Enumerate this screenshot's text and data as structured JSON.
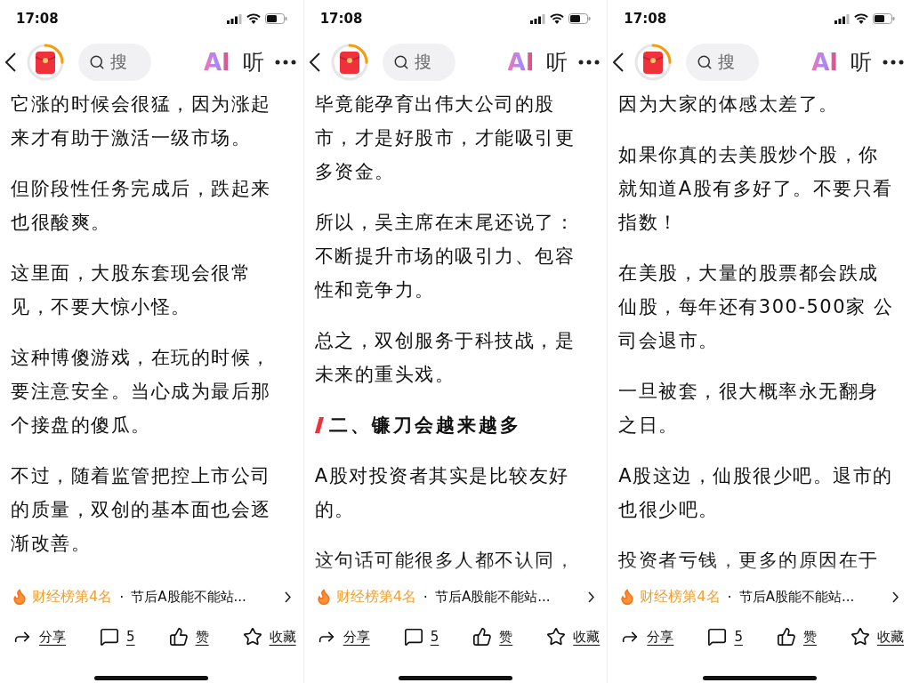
{
  "screens": [
    {
      "status_bar": {
        "time": "17:08"
      },
      "nav": {
        "search": {
          "placeholder": "搜"
        },
        "ai_label": "AI",
        "listen_label": "听"
      },
      "article": [
        {
          "kind": "paragraph",
          "lines": [
            "它涨的时候会很猛，因为涨起",
            "来才有助于激活一级市场。"
          ]
        },
        {
          "kind": "paragraph",
          "lines": [
            "但阶段性任务完成后，跌起来",
            "也很酸爽。"
          ]
        },
        {
          "kind": "paragraph",
          "lines": [
            "这里面，大股东套现会很常",
            "见，不要大惊小怪。"
          ]
        },
        {
          "kind": "paragraph",
          "lines": [
            "这种博傻游戏，在玩的时候，",
            "要注意安全。当心成为最后那",
            "个接盘的傻瓜。"
          ]
        },
        {
          "kind": "paragraph",
          "lines": [
            "不过，随着监管把控上市公司",
            "的质量，双创的基本面也会逐",
            "渐改善。"
          ]
        }
      ],
      "ranking": {
        "label": "财经榜第4名",
        "separator": "·",
        "headline": "节后A股能不能站..."
      },
      "actions": [
        {
          "kind": "share",
          "label": "分享"
        },
        {
          "kind": "comment",
          "label": "5"
        },
        {
          "kind": "like",
          "label": "赞"
        },
        {
          "kind": "favorite",
          "label": "收藏"
        }
      ]
    },
    {
      "status_bar": {
        "time": "17:08"
      },
      "nav": {
        "search": {
          "placeholder": "搜"
        },
        "ai_label": "AI",
        "listen_label": "听"
      },
      "article": [
        {
          "kind": "paragraph",
          "lines": [
            "毕竟能孕育出伟大公司的股",
            "市，才是好股市，才能吸引更",
            "多资金。"
          ]
        },
        {
          "kind": "paragraph",
          "lines": [
            "所以，吴主席在末尾还说了：",
            "不断提升市场的吸引力、包容",
            "性和竞争力。"
          ]
        },
        {
          "kind": "paragraph",
          "lines": [
            "总之，双创服务于科技战，是",
            "未来的重头戏。"
          ]
        },
        {
          "kind": "heading",
          "lines": [
            "二、镰刀会越来越多"
          ]
        },
        {
          "kind": "paragraph",
          "lines": [
            "A股对投资者其实是比较友好",
            "的。"
          ]
        },
        {
          "kind": "paragraph",
          "lines": [
            "这句话可能很多人都不认同，"
          ]
        }
      ],
      "ranking": {
        "label": "财经榜第4名",
        "separator": "·",
        "headline": "节后A股能不能站..."
      },
      "actions": [
        {
          "kind": "share",
          "label": "分享"
        },
        {
          "kind": "comment",
          "label": "5"
        },
        {
          "kind": "like",
          "label": "赞"
        },
        {
          "kind": "favorite",
          "label": "收藏"
        }
      ]
    },
    {
      "status_bar": {
        "time": "17:08"
      },
      "nav": {
        "search": {
          "placeholder": "搜"
        },
        "ai_label": "AI",
        "listen_label": "听"
      },
      "article": [
        {
          "kind": "paragraph",
          "lines": [
            "因为大家的体感太差了。"
          ]
        },
        {
          "kind": "paragraph",
          "lines": [
            "如果你真的去美股炒个股，你",
            "就知道A股有多好了。不要只看",
            "指数！"
          ]
        },
        {
          "kind": "paragraph",
          "lines": [
            "在美股，大量的股票都会跌成",
            "仙股，每年还有300-500家 公",
            "司会退市。"
          ]
        },
        {
          "kind": "paragraph",
          "lines": [
            "一旦被套，很大概率永无翻身",
            "之日。"
          ]
        },
        {
          "kind": "paragraph",
          "lines": [
            "A股这边，仙股很少吧。退市的",
            "也很少吧。"
          ]
        },
        {
          "kind": "paragraph",
          "lines": [
            "投资者亏钱，更多的原因在于"
          ]
        }
      ],
      "ranking": {
        "label": "财经榜第4名",
        "separator": "·",
        "headline": "节后A股能不能站..."
      },
      "actions": [
        {
          "kind": "share",
          "label": "分享"
        },
        {
          "kind": "comment",
          "label": "5"
        },
        {
          "kind": "like",
          "label": "赞"
        },
        {
          "kind": "favorite",
          "label": "收藏"
        }
      ]
    }
  ]
}
